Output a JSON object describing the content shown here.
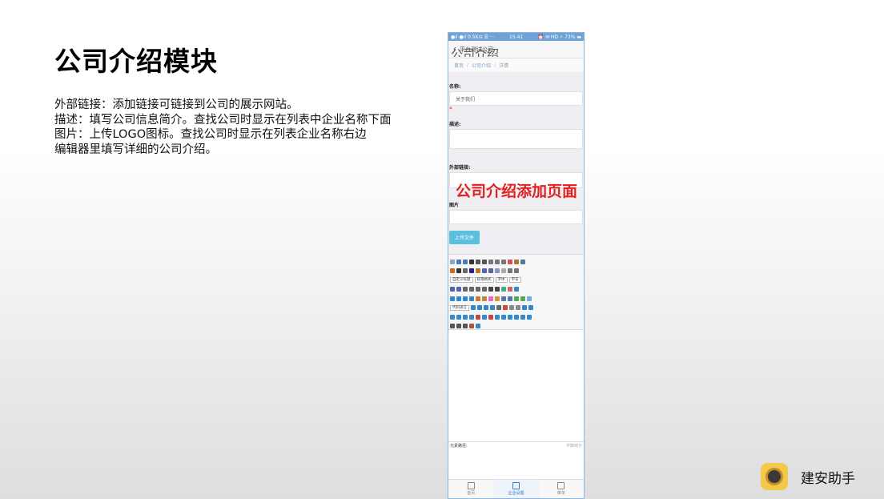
{
  "slide": {
    "title": "公司介绍模块",
    "lines": [
      "外部链接：添加链接可链接到公司的展示网站。",
      "描述：填写公司信息简介。查找公司时显示在列表中企业名称下面",
      "图片：上传LOGO图标。查找公司时显示在列表企业名称右边",
      "编辑器里填写详细的公司介绍。"
    ],
    "overlay_label": "公司介绍添加页面",
    "brand_name": "建安助手"
  },
  "phone": {
    "status_left": "●ıl ●ıl 0.5K/s ☰ ···",
    "status_time": "15:41",
    "status_right": "⏰ ✉ HD ⚡ 73% ▬",
    "nav_title": "平台测试公司",
    "heading_ghost": "公司介绍",
    "breadcrumbs": [
      "首页",
      "公司介绍",
      "详情"
    ],
    "form": {
      "name_label": "名称:",
      "name_value": "关于我们",
      "required_mark": "*",
      "desc_label": "描述:",
      "link_label": "外部链接:",
      "image_label": "图片",
      "upload_button": "上传文件"
    },
    "editor": {
      "custom_title_select": "自定义标题",
      "paragraph_select": "段落格式",
      "font_select": "字体",
      "size_select": "字号",
      "code_lang_select": "代码语言",
      "path_label": "元素路径:",
      "word_count": "字数统计"
    },
    "tabs": [
      {
        "label": "首页",
        "icon": "home-icon"
      },
      {
        "label": "企业设置",
        "icon": "list-icon"
      },
      {
        "label": "菜单",
        "icon": "grid-icon"
      }
    ]
  },
  "colors": {
    "accent": "#3a77c8",
    "overlay": "#e32020",
    "upload_button": "#5bc0de"
  }
}
